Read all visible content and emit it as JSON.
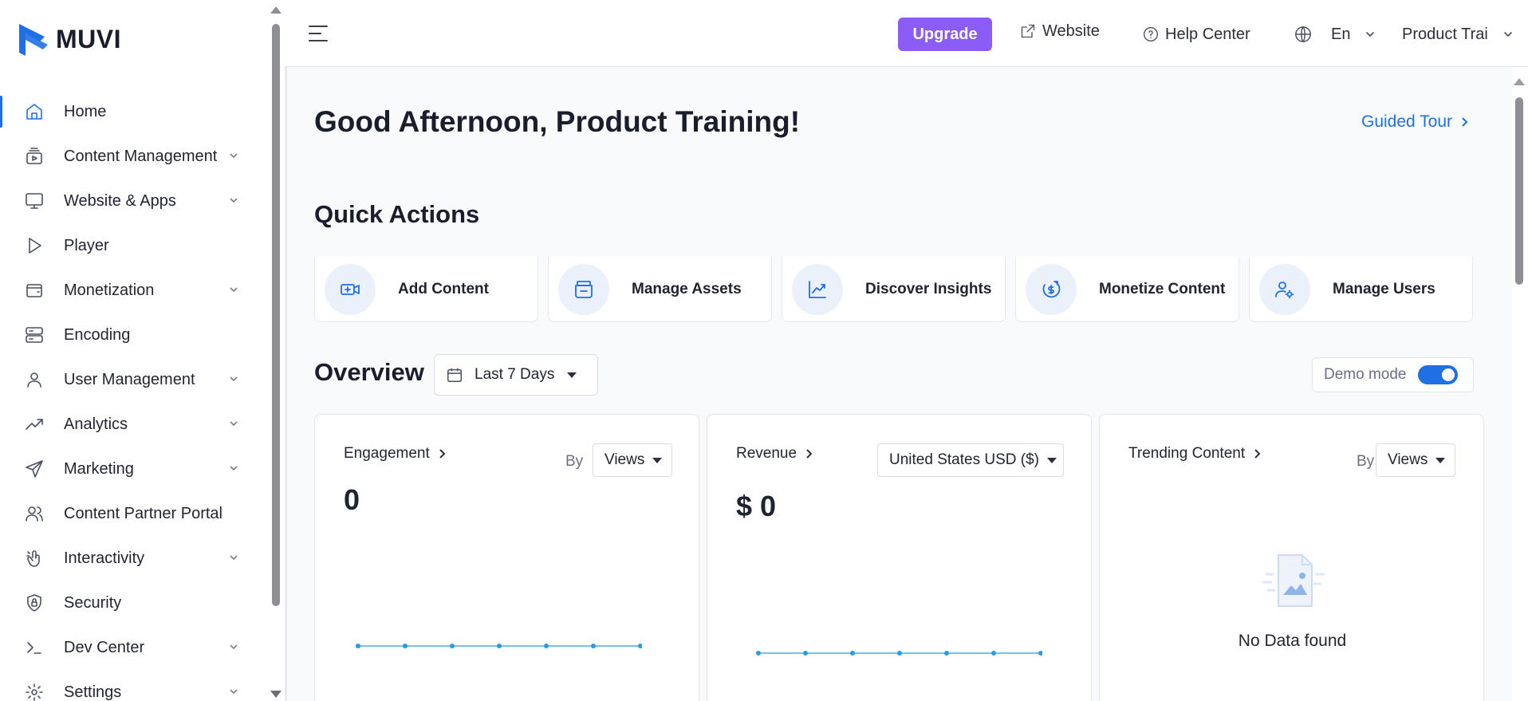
{
  "brand": {
    "name": "MUVI",
    "accent": "#1f6fe5",
    "upgrade_color": "#8b5cf6"
  },
  "sidebar": {
    "items": [
      {
        "label": "Home",
        "icon": "home-icon",
        "active": true,
        "expandable": false
      },
      {
        "label": "Content Management",
        "icon": "content-management-icon",
        "expandable": true
      },
      {
        "label": "Website & Apps",
        "icon": "monitor-icon",
        "expandable": true
      },
      {
        "label": "Player",
        "icon": "play-icon",
        "expandable": false
      },
      {
        "label": "Monetization",
        "icon": "wallet-icon",
        "expandable": true
      },
      {
        "label": "Encoding",
        "icon": "server-icon",
        "expandable": false
      },
      {
        "label": "User Management",
        "icon": "user-icon",
        "expandable": true
      },
      {
        "label": "Analytics",
        "icon": "trend-icon",
        "expandable": true
      },
      {
        "label": "Marketing",
        "icon": "send-icon",
        "expandable": true
      },
      {
        "label": "Content Partner Portal",
        "icon": "users-icon",
        "expandable": false
      },
      {
        "label": "Interactivity",
        "icon": "tap-icon",
        "expandable": true
      },
      {
        "label": "Security",
        "icon": "shield-icon",
        "expandable": false
      },
      {
        "label": "Dev Center",
        "icon": "terminal-icon",
        "expandable": true
      },
      {
        "label": "Settings",
        "icon": "gear-icon",
        "expandable": true
      }
    ]
  },
  "topbar": {
    "upgrade": "Upgrade",
    "website": "Website",
    "help": "Help Center",
    "language": "En",
    "user": "Product Trai"
  },
  "main": {
    "greeting": "Good Afternoon, Product Training!",
    "guided_tour": "Guided Tour",
    "quick_actions_title": "Quick Actions",
    "quick_actions": [
      {
        "label": "Add Content",
        "icon": "add-video-icon"
      },
      {
        "label": "Manage Assets",
        "icon": "assets-icon"
      },
      {
        "label": "Discover Insights",
        "icon": "insights-icon"
      },
      {
        "label": "Monetize Content",
        "icon": "monetize-icon"
      },
      {
        "label": "Manage Users",
        "icon": "user-settings-icon"
      }
    ],
    "overview_title": "Overview",
    "date_range": "Last 7 Days",
    "demo_mode": {
      "label": "Demo mode",
      "on": true
    }
  },
  "panels": {
    "engagement": {
      "title": "Engagement",
      "by": "By",
      "select": "Views",
      "value": "0"
    },
    "revenue": {
      "title": "Revenue",
      "select": "United States USD ($)",
      "value": "$ 0"
    },
    "trending": {
      "title": "Trending Content",
      "by": "By",
      "select": "Views",
      "empty": "No Data found"
    }
  },
  "chart_data": [
    {
      "type": "line",
      "series": [
        {
          "values": [
            0,
            0,
            0,
            0,
            0,
            0,
            0
          ]
        }
      ]
    },
    {
      "type": "line",
      "series": [
        {
          "values": [
            0,
            0,
            0,
            0,
            0,
            0,
            0
          ]
        }
      ]
    }
  ]
}
